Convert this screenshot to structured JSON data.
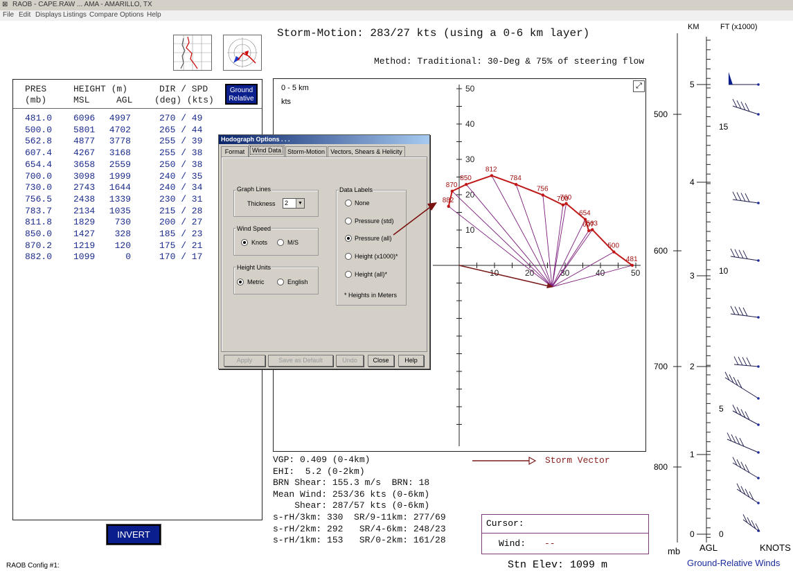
{
  "window": {
    "title": "RAOB - CAPE.RAW ... AMA - AMARILLO, TX"
  },
  "menu": [
    "File",
    "Edit",
    "Displays",
    "Listings",
    "Compare",
    "Options",
    "Help"
  ],
  "storm_motion": "Storm-Motion: 283/27 kts (using a 0-6 km layer)",
  "method": "Method: Traditional: 30-Deg & 75% of steering flow",
  "table": {
    "headers": {
      "pres": "PRES",
      "pres_unit": "(mb)",
      "height": "HEIGHT (m)",
      "msl": "MSL",
      "agl": "AGL",
      "dirspd": "DIR / SPD",
      "dirspd_unit": "(deg) (kts)"
    },
    "rows": [
      {
        "pres": "481.0",
        "msl": "6096",
        "agl": "4997",
        "wind": "270 / 49"
      },
      {
        "pres": "500.0",
        "msl": "5801",
        "agl": "4702",
        "wind": "265 / 44"
      },
      {
        "pres": "562.8",
        "msl": "4877",
        "agl": "3778",
        "wind": "255 / 39"
      },
      {
        "pres": "607.4",
        "msl": "4267",
        "agl": "3168",
        "wind": "255 / 38"
      },
      {
        "pres": "654.4",
        "msl": "3658",
        "agl": "2559",
        "wind": "250 / 38"
      },
      {
        "pres": "700.0",
        "msl": "3098",
        "agl": "1999",
        "wind": "240 / 35"
      },
      {
        "pres": "730.0",
        "msl": "2743",
        "agl": "1644",
        "wind": "240 / 34"
      },
      {
        "pres": "756.5",
        "msl": "2438",
        "agl": "1339",
        "wind": "230 / 31"
      },
      {
        "pres": "783.7",
        "msl": "2134",
        "agl": "1035",
        "wind": "215 / 28"
      },
      {
        "pres": "811.8",
        "msl": "1829",
        "agl": "730",
        "wind": "200 / 27"
      },
      {
        "pres": "850.0",
        "msl": "1427",
        "agl": "328",
        "wind": "185 / 23"
      },
      {
        "pres": "870.2",
        "msl": "1219",
        "agl": "120",
        "wind": "175 / 21"
      },
      {
        "pres": "882.0",
        "msl": "1099",
        "agl": "0",
        "wind": "170 / 17"
      }
    ]
  },
  "buttons": {
    "ground_relative": "Ground Relative",
    "invert": "INVERT"
  },
  "hodograph": {
    "range_label": "0 - 5 km",
    "units": "kts",
    "y_ticks": [
      "50",
      "40",
      "30",
      "20",
      "10"
    ],
    "x_ticks": [
      "10",
      "20",
      "30",
      "40",
      "50"
    ],
    "points": [
      {
        "label": "882",
        "u": -3,
        "v": 16.7
      },
      {
        "label": "870",
        "u": -2,
        "v": 21
      },
      {
        "label": "850",
        "u": 2,
        "v": 22.9
      },
      {
        "label": "812",
        "u": 9.2,
        "v": 25.4
      },
      {
        "label": "784",
        "u": 16.1,
        "v": 22.9
      },
      {
        "label": "756",
        "u": 23.7,
        "v": 19.9
      },
      {
        "label": "700",
        "u": 29.4,
        "v": 17.1
      },
      {
        "label": "760",
        "u": 30.3,
        "v": 17.5
      },
      {
        "label": "654",
        "u": 35.7,
        "v": 13
      },
      {
        "label": "607",
        "u": 36.7,
        "v": 9.8
      },
      {
        "label": "563",
        "u": 37.7,
        "v": 10.1
      },
      {
        "label": "500",
        "u": 43.8,
        "v": 3.8
      },
      {
        "label": "481",
        "u": 49,
        "v": 0
      }
    ],
    "storm": {
      "u": 26.3,
      "v": -6.1
    },
    "storm_vector_label": "Storm Vector"
  },
  "stats": [
    "VGP: 0.409 (0-4km)",
    "EHI:  5.2 (0-2km)",
    "BRN Shear: 155.3 m/s  BRN: 18",
    "Mean Wind: 253/36 kts (0-6km)",
    "    Shear: 287/57 kts (0-6km)",
    "s-rH/3km: 330  SR/9-11km: 277/69",
    "s-rH/2km: 292   SR/4-6km: 248/23",
    "s-rH/1km: 153   SR/0-2km: 161/28"
  ],
  "cursor": {
    "label": "Cursor:",
    "wind_label": "Wind:",
    "wind_value": "--"
  },
  "stn_elev": "Stn Elev: 1099 m",
  "config": "RAOB Config #1:",
  "right_axis": {
    "km_label": "KM",
    "ft_label": "FT (x1000)",
    "mb_ticks": [
      "500",
      "600",
      "700",
      "800"
    ],
    "km_ticks": [
      "5",
      "4",
      "3",
      "2",
      "1",
      "0"
    ],
    "ft_ticks": [
      "15",
      "10",
      "5",
      "0"
    ],
    "mb_label": "mb",
    "agl_label": "AGL",
    "knots_label": "KNOTS",
    "caption": "Ground-Relative Winds"
  },
  "dialog": {
    "title": "Hodograph Options . . .",
    "tabs": [
      "Format",
      "Wind Data",
      "Storm-Motion",
      "Vectors, Shears & Helicity"
    ],
    "graph_lines": {
      "label": "Graph Lines",
      "thickness_label": "Thickness",
      "thickness_value": "2"
    },
    "wind_speed": {
      "label": "Wind Speed",
      "options": [
        "Knots",
        "M/S"
      ],
      "selected": "Knots"
    },
    "height_units": {
      "label": "Height Units",
      "options": [
        "Metric",
        "English"
      ],
      "selected": "Metric"
    },
    "data_labels": {
      "label": "Data Labels",
      "options": [
        "None",
        "Pressure (std)",
        "Pressure (all)",
        "Height (x1000)*",
        "Height (all)*"
      ],
      "selected": "Pressure (all)",
      "note": "* Heights in Meters"
    },
    "buttons": [
      "Apply",
      "Save as Default",
      "Undo",
      "Close",
      "Help"
    ]
  },
  "colors": {
    "accent_blue": "#0a1e8c",
    "hodo_red": "#c01818",
    "hodo_purple": "#7a1a7a",
    "row_blue": "#1a2a8c"
  }
}
